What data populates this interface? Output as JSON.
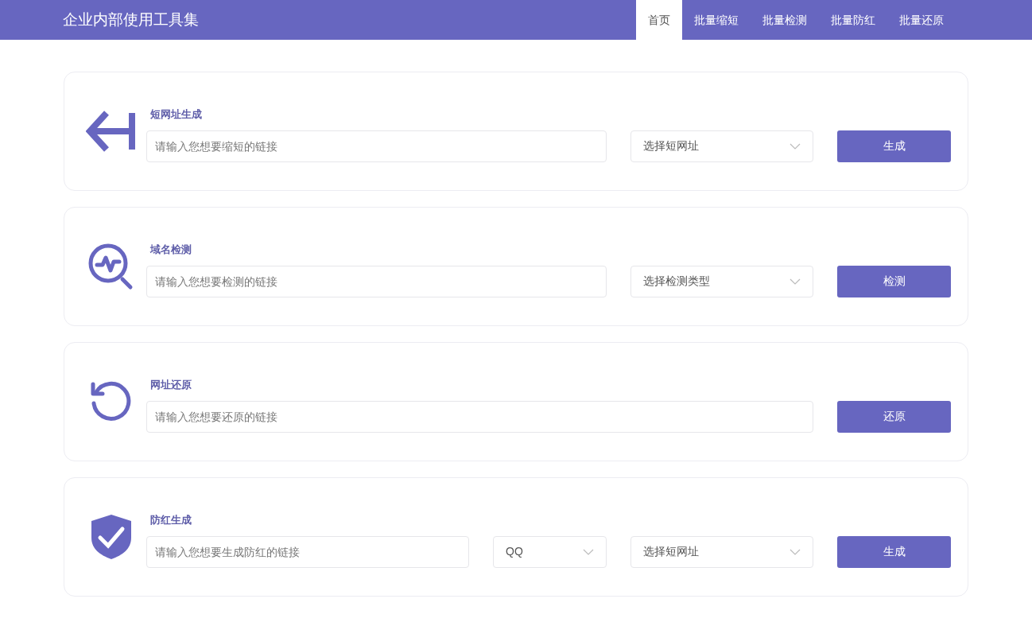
{
  "header": {
    "title": "企业内部使用工具集",
    "nav": [
      {
        "label": "首页",
        "selected": true
      },
      {
        "label": "批量缩短",
        "selected": false
      },
      {
        "label": "批量检测",
        "selected": false
      },
      {
        "label": "批量防红",
        "selected": false
      },
      {
        "label": "批量还原",
        "selected": false
      }
    ]
  },
  "cards": [
    {
      "kind": "shorten",
      "title": "短网址生成",
      "input": {
        "placeholder": "请输入您想要缩短的链接"
      },
      "selects": [
        {
          "text": "选择短网址",
          "kind": "wide"
        }
      ],
      "button": "生成"
    },
    {
      "kind": "check",
      "title": "域名检测",
      "input": {
        "placeholder": "请输入您想要检测的链接"
      },
      "selects": [
        {
          "text": "选择检测类型",
          "kind": "wide"
        }
      ],
      "button": "检测"
    },
    {
      "kind": "restore",
      "title": "网址还原",
      "input": {
        "placeholder": "请输入您想要还原的链接"
      },
      "button": "还原"
    },
    {
      "kind": "protect",
      "title": "防红生成",
      "input": {
        "placeholder": "请输入您想要生成防红的链接"
      },
      "selects": [
        {
          "text": "QQ",
          "kind": "narrow"
        },
        {
          "text": "选择短网址",
          "kind": "wide"
        }
      ],
      "button": "生成"
    }
  ]
}
